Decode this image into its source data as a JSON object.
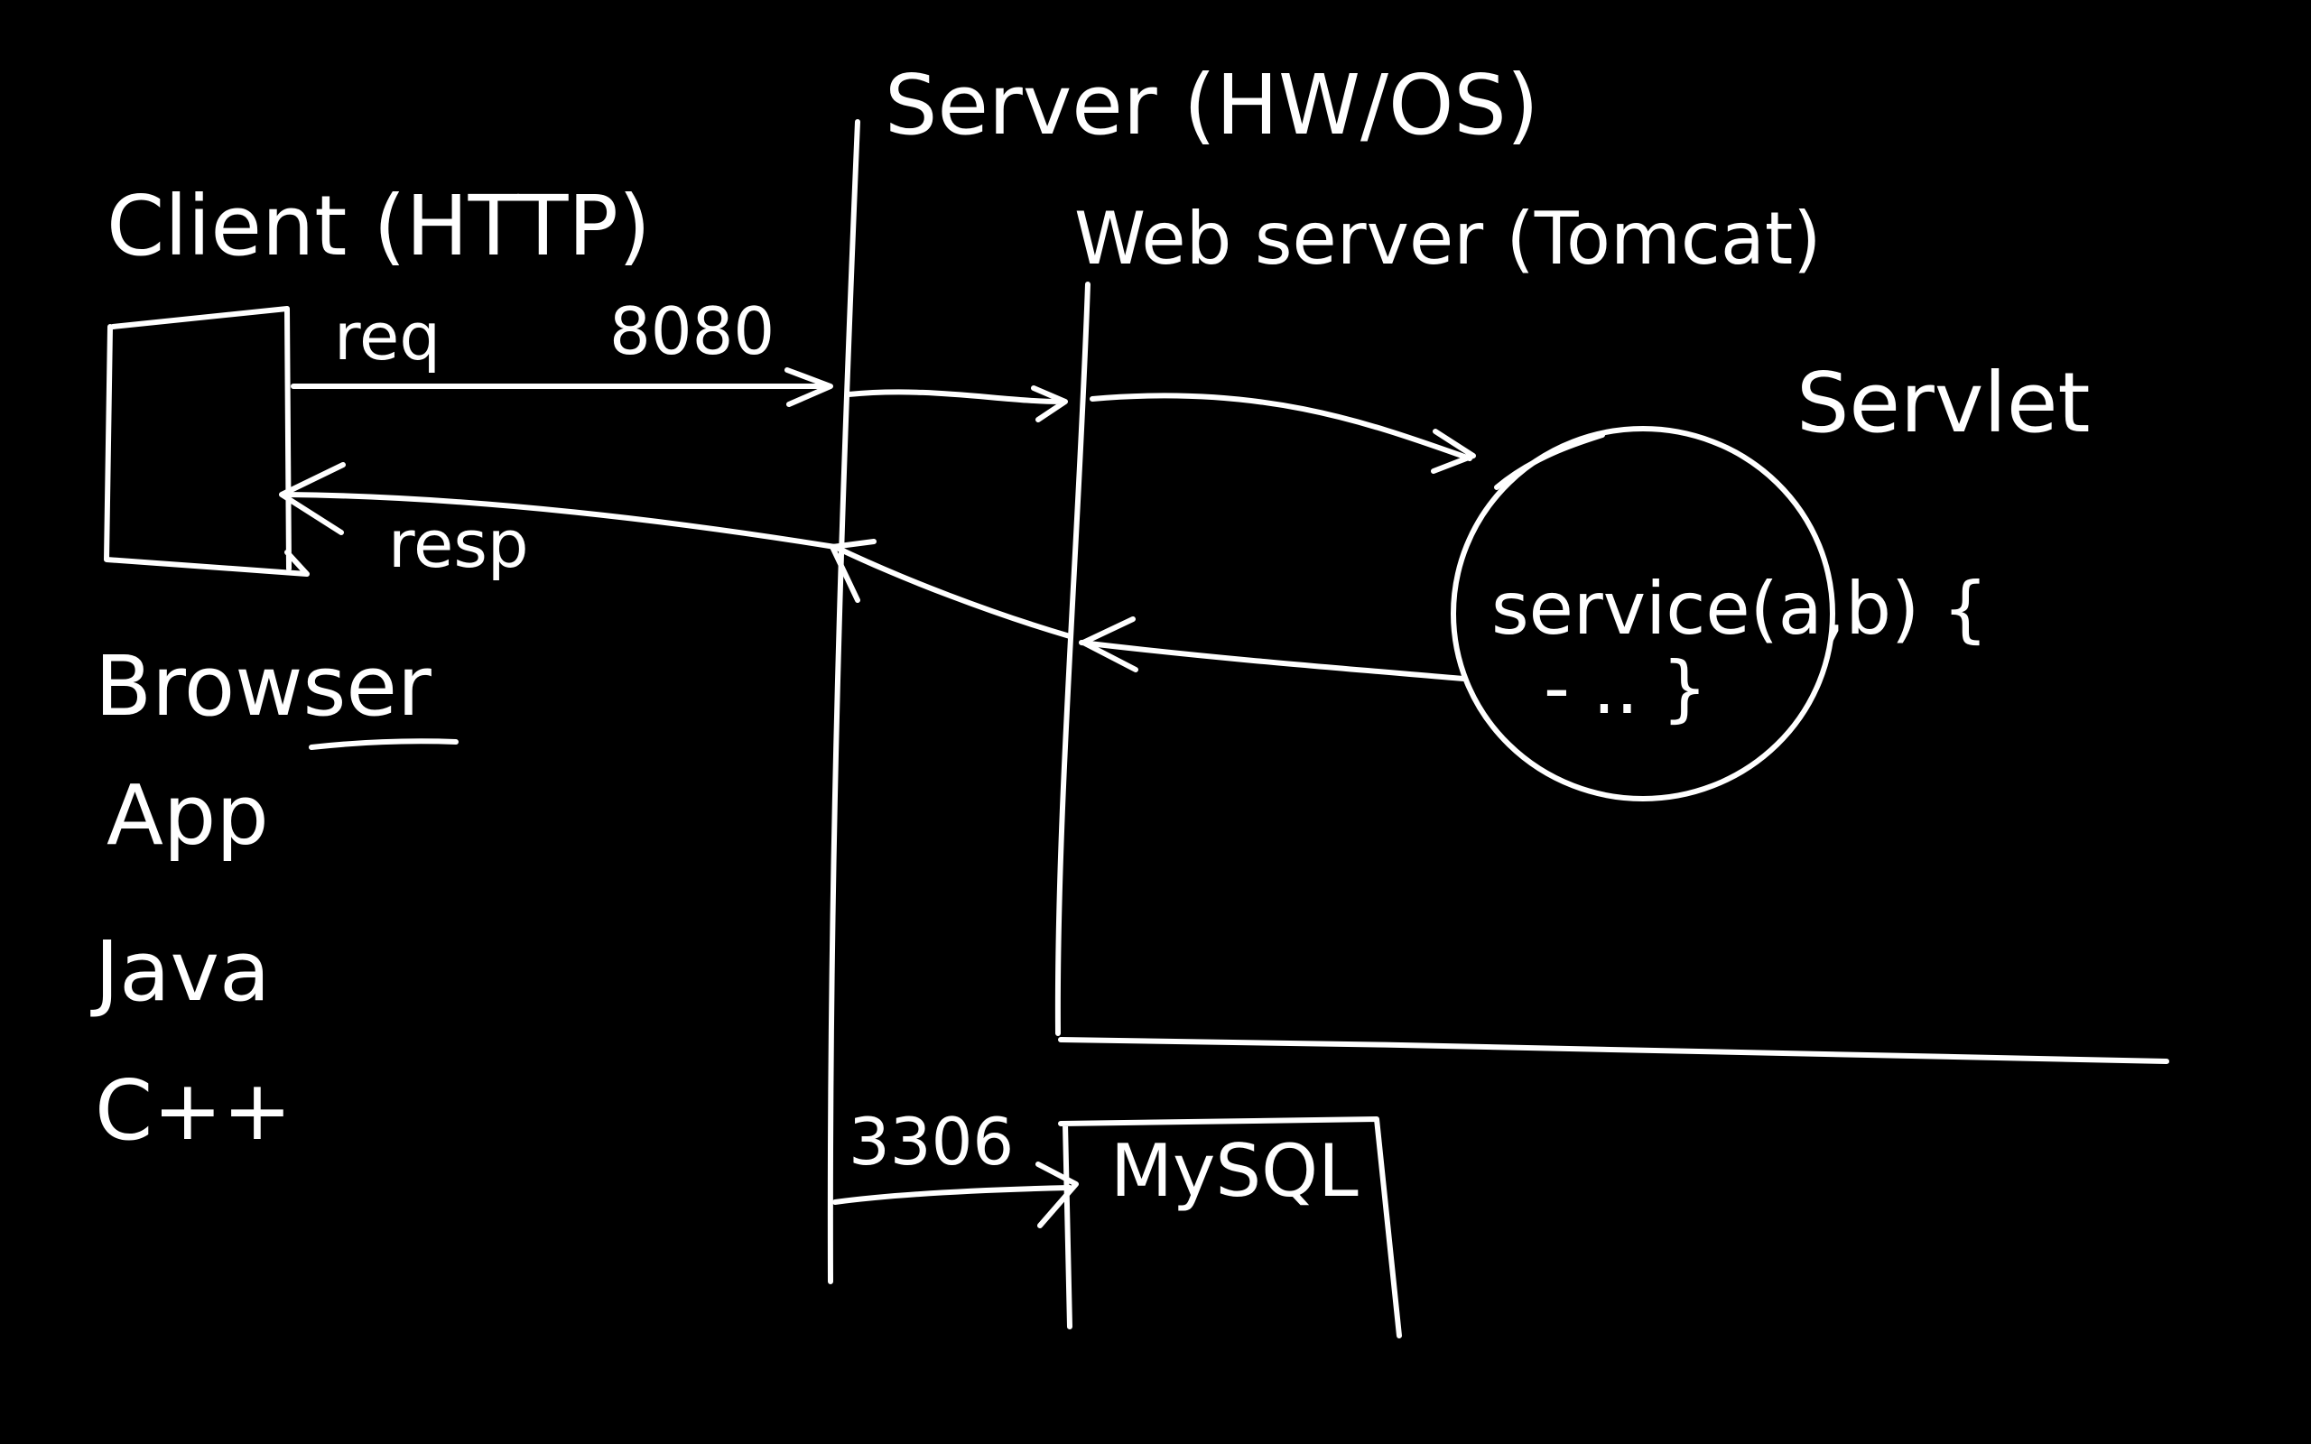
{
  "canvas": {
    "background": "#000000",
    "ink": "#ffffff"
  },
  "labels": {
    "client": "Client (HTTP)",
    "server": "Server (HW/OS)",
    "web_server": "Web server (Tomcat)",
    "servlet": "Servlet",
    "req": "req",
    "port_http": "8080",
    "resp": "resp",
    "service_signature": "service(a,b) {",
    "service_body": "- .. }",
    "port_db": "3306",
    "database": "MySQL",
    "client_types": [
      "Browser",
      "App",
      "Java",
      "C++"
    ]
  }
}
